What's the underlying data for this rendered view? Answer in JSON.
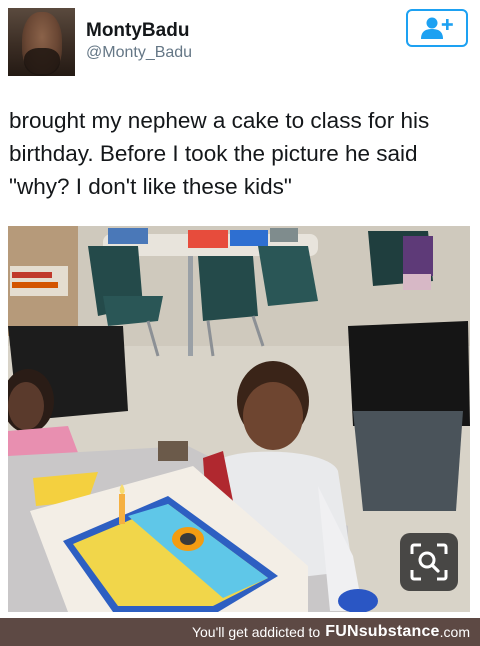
{
  "tweet": {
    "display_name": "MontyBadu",
    "handle": "@Monty_Badu",
    "text": "brought my nephew a cake to class for his birthday. Before I took the picture he said \"why? I don't like these kids\"",
    "follow_icon": "add-user-icon",
    "accent_color": "#1da1f2"
  },
  "photo": {
    "visual_search_icon": "visual-search-icon"
  },
  "footer": {
    "tagline": "You'll get addicted to",
    "brand": "FUNsubstance",
    "brand_suffix": ".com",
    "background_color": "#5d4944"
  }
}
